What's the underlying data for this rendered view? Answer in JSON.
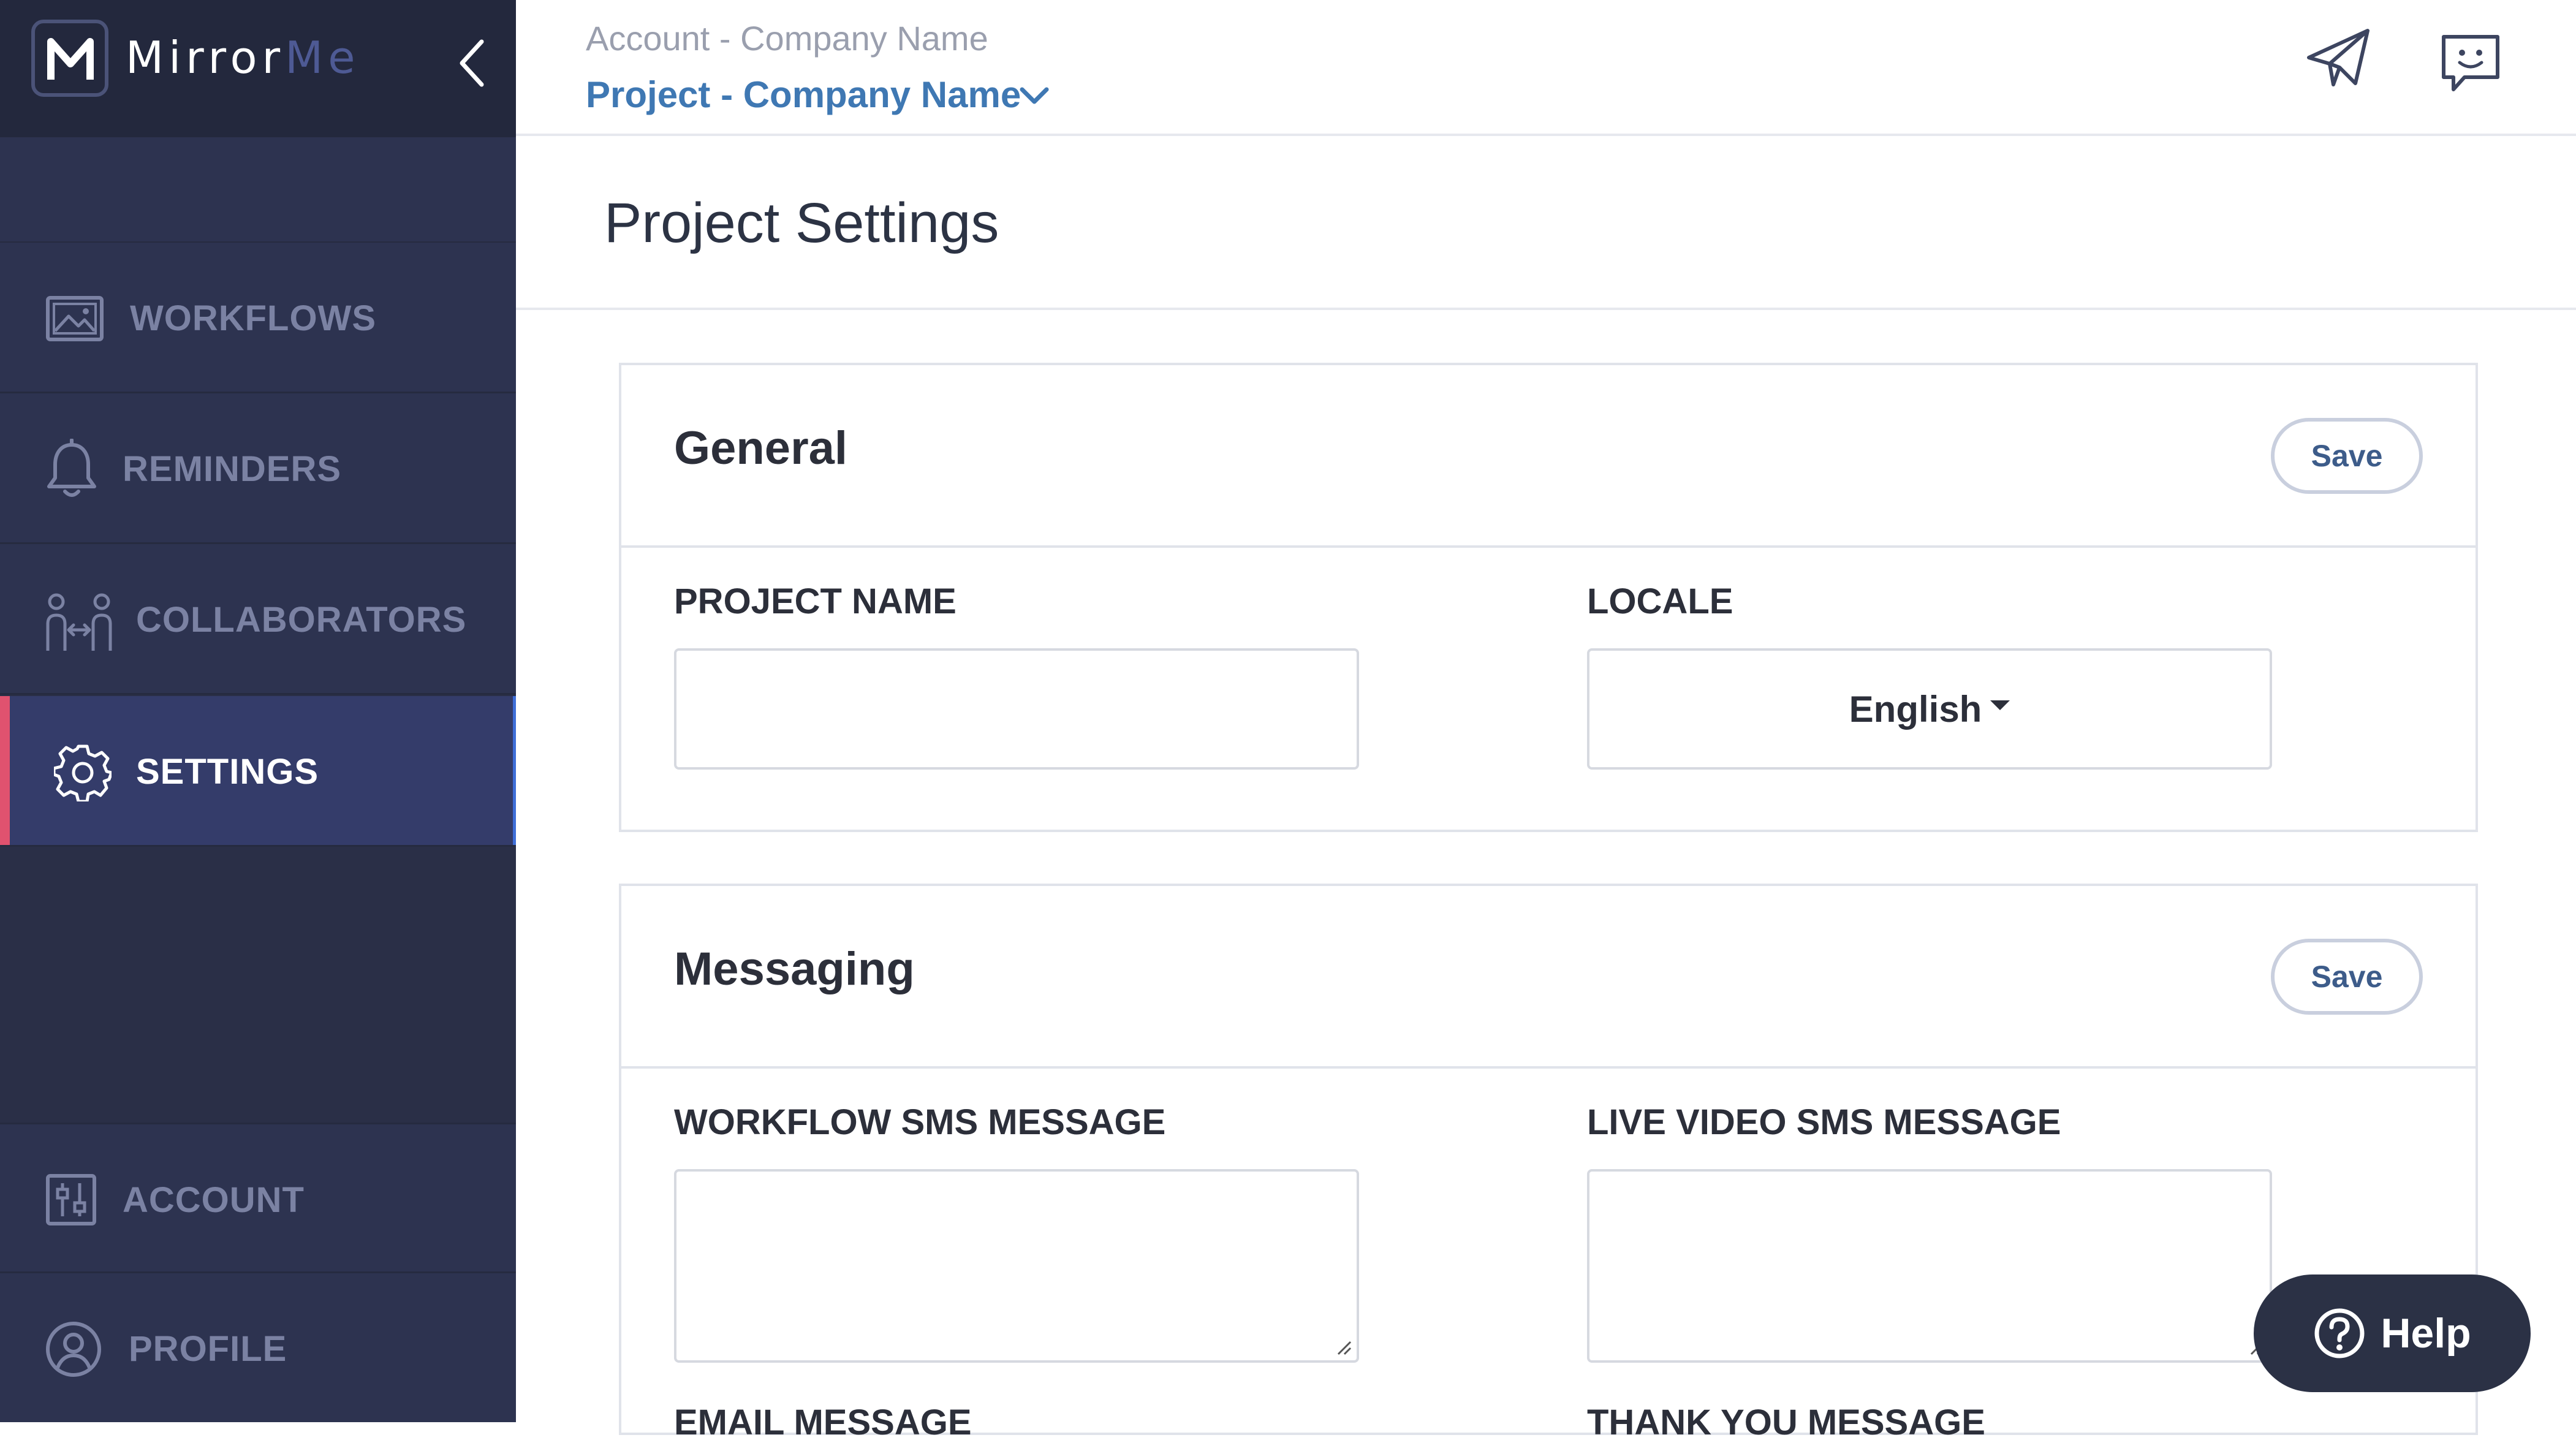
{
  "brand": {
    "logo_letter": "M",
    "name_part1": "Mirror",
    "name_part2": "Me"
  },
  "sidebar": {
    "items": [
      {
        "label": "WORKFLOWS",
        "icon": "image-icon",
        "active": false
      },
      {
        "label": "REMINDERS",
        "icon": "bell-icon",
        "active": false
      },
      {
        "label": "COLLABORATORS",
        "icon": "collaborators-icon",
        "active": false
      },
      {
        "label": "SETTINGS",
        "icon": "gear-icon",
        "active": true
      }
    ],
    "bottom_items": [
      {
        "label": "ACCOUNT",
        "icon": "sliders-icon"
      },
      {
        "label": "PROFILE",
        "icon": "user-icon"
      }
    ]
  },
  "header": {
    "account_crumb": "Account - Company Name",
    "project_crumb": "Project - Company Name"
  },
  "page": {
    "title": "Project Settings"
  },
  "general": {
    "title": "General",
    "save_label": "Save",
    "project_name_label": "PROJECT NAME",
    "project_name_value": "",
    "locale_label": "LOCALE",
    "locale_value": "English"
  },
  "messaging": {
    "title": "Messaging",
    "save_label": "Save",
    "workflow_sms_label": "WORKFLOW SMS MESSAGE",
    "live_video_sms_label": "LIVE VIDEO SMS MESSAGE",
    "email_message_label": "EMAIL MESSAGE",
    "thank_you_label": "THANK YOU MESSAGE"
  },
  "help": {
    "label": "Help"
  },
  "colors": {
    "sidebar_bg": "#2a2f47",
    "active_item_bg": "#343c6a",
    "active_accent": "#e0526f",
    "link_blue": "#3f78b3"
  }
}
